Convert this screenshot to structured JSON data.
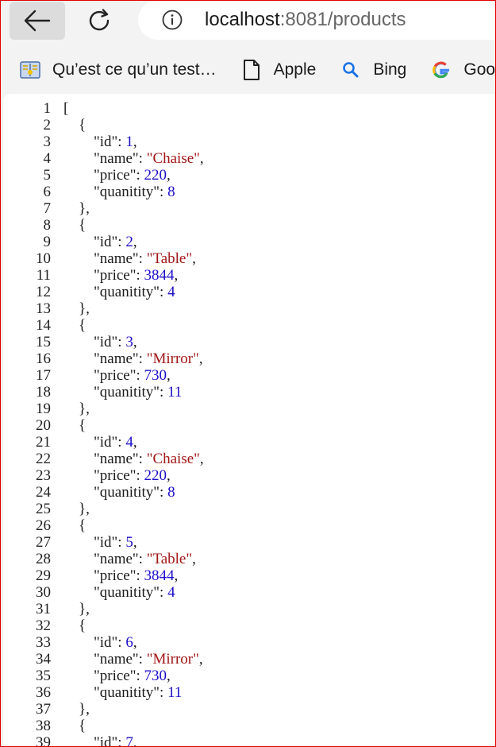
{
  "browser": {
    "url_host": "localhost",
    "url_rest": ":8081/products"
  },
  "bookmarks": [
    {
      "label": "Qu’est ce qu’un test…",
      "icon": "book-icon"
    },
    {
      "label": "Apple",
      "icon": "file-icon"
    },
    {
      "label": "Bing",
      "icon": "search-icon"
    },
    {
      "label": "Goog",
      "icon": "google-icon"
    }
  ],
  "json_lines": [
    {
      "n": "1",
      "parts": [
        [
          "p",
          "["
        ]
      ]
    },
    {
      "n": "2",
      "parts": [
        [
          "p",
          "    {"
        ]
      ]
    },
    {
      "n": "3",
      "parts": [
        [
          "p",
          "        \"id\": "
        ],
        [
          "num",
          "1"
        ],
        [
          "p",
          ","
        ]
      ]
    },
    {
      "n": "4",
      "parts": [
        [
          "p",
          "        \"name\": "
        ],
        [
          "str",
          "\"Chaise\""
        ],
        [
          "p",
          ","
        ]
      ]
    },
    {
      "n": "5",
      "parts": [
        [
          "p",
          "        \"price\": "
        ],
        [
          "num",
          "220"
        ],
        [
          "p",
          ","
        ]
      ]
    },
    {
      "n": "6",
      "parts": [
        [
          "p",
          "        \"quanitity\": "
        ],
        [
          "num",
          "8"
        ]
      ]
    },
    {
      "n": "7",
      "parts": [
        [
          "p",
          "    },"
        ]
      ]
    },
    {
      "n": "8",
      "parts": [
        [
          "p",
          "    {"
        ]
      ]
    },
    {
      "n": "9",
      "parts": [
        [
          "p",
          "        \"id\": "
        ],
        [
          "num",
          "2"
        ],
        [
          "p",
          ","
        ]
      ]
    },
    {
      "n": "10",
      "parts": [
        [
          "p",
          "        \"name\": "
        ],
        [
          "str",
          "\"Table\""
        ],
        [
          "p",
          ","
        ]
      ]
    },
    {
      "n": "11",
      "parts": [
        [
          "p",
          "        \"price\": "
        ],
        [
          "num",
          "3844"
        ],
        [
          "p",
          ","
        ]
      ]
    },
    {
      "n": "12",
      "parts": [
        [
          "p",
          "        \"quanitity\": "
        ],
        [
          "num",
          "4"
        ]
      ]
    },
    {
      "n": "13",
      "parts": [
        [
          "p",
          "    },"
        ]
      ]
    },
    {
      "n": "14",
      "parts": [
        [
          "p",
          "    {"
        ]
      ]
    },
    {
      "n": "15",
      "parts": [
        [
          "p",
          "        \"id\": "
        ],
        [
          "num",
          "3"
        ],
        [
          "p",
          ","
        ]
      ]
    },
    {
      "n": "16",
      "parts": [
        [
          "p",
          "        \"name\": "
        ],
        [
          "str",
          "\"Mirror\""
        ],
        [
          "p",
          ","
        ]
      ]
    },
    {
      "n": "17",
      "parts": [
        [
          "p",
          "        \"price\": "
        ],
        [
          "num",
          "730"
        ],
        [
          "p",
          ","
        ]
      ]
    },
    {
      "n": "18",
      "parts": [
        [
          "p",
          "        \"quanitity\": "
        ],
        [
          "num",
          "11"
        ]
      ]
    },
    {
      "n": "19",
      "parts": [
        [
          "p",
          "    },"
        ]
      ]
    },
    {
      "n": "20",
      "parts": [
        [
          "p",
          "    {"
        ]
      ]
    },
    {
      "n": "21",
      "parts": [
        [
          "p",
          "        \"id\": "
        ],
        [
          "num",
          "4"
        ],
        [
          "p",
          ","
        ]
      ]
    },
    {
      "n": "22",
      "parts": [
        [
          "p",
          "        \"name\": "
        ],
        [
          "str",
          "\"Chaise\""
        ],
        [
          "p",
          ","
        ]
      ]
    },
    {
      "n": "23",
      "parts": [
        [
          "p",
          "        \"price\": "
        ],
        [
          "num",
          "220"
        ],
        [
          "p",
          ","
        ]
      ]
    },
    {
      "n": "24",
      "parts": [
        [
          "p",
          "        \"quanitity\": "
        ],
        [
          "num",
          "8"
        ]
      ]
    },
    {
      "n": "25",
      "parts": [
        [
          "p",
          "    },"
        ]
      ]
    },
    {
      "n": "26",
      "parts": [
        [
          "p",
          "    {"
        ]
      ]
    },
    {
      "n": "27",
      "parts": [
        [
          "p",
          "        \"id\": "
        ],
        [
          "num",
          "5"
        ],
        [
          "p",
          ","
        ]
      ]
    },
    {
      "n": "28",
      "parts": [
        [
          "p",
          "        \"name\": "
        ],
        [
          "str",
          "\"Table\""
        ],
        [
          "p",
          ","
        ]
      ]
    },
    {
      "n": "29",
      "parts": [
        [
          "p",
          "        \"price\": "
        ],
        [
          "num",
          "3844"
        ],
        [
          "p",
          ","
        ]
      ]
    },
    {
      "n": "30",
      "parts": [
        [
          "p",
          "        \"quanitity\": "
        ],
        [
          "num",
          "4"
        ]
      ]
    },
    {
      "n": "31",
      "parts": [
        [
          "p",
          "    },"
        ]
      ]
    },
    {
      "n": "32",
      "parts": [
        [
          "p",
          "    {"
        ]
      ]
    },
    {
      "n": "33",
      "parts": [
        [
          "p",
          "        \"id\": "
        ],
        [
          "num",
          "6"
        ],
        [
          "p",
          ","
        ]
      ]
    },
    {
      "n": "34",
      "parts": [
        [
          "p",
          "        \"name\": "
        ],
        [
          "str",
          "\"Mirror\""
        ],
        [
          "p",
          ","
        ]
      ]
    },
    {
      "n": "35",
      "parts": [
        [
          "p",
          "        \"price\": "
        ],
        [
          "num",
          "730"
        ],
        [
          "p",
          ","
        ]
      ]
    },
    {
      "n": "36",
      "parts": [
        [
          "p",
          "        \"quanitity\": "
        ],
        [
          "num",
          "11"
        ]
      ]
    },
    {
      "n": "37",
      "parts": [
        [
          "p",
          "    },"
        ]
      ]
    },
    {
      "n": "38",
      "parts": [
        [
          "p",
          "    {"
        ]
      ]
    },
    {
      "n": "39",
      "parts": [
        [
          "p",
          "        \"id\": "
        ],
        [
          "num",
          "7"
        ],
        [
          "p",
          ","
        ]
      ]
    }
  ],
  "colors": {
    "string": "#a31515",
    "number": "#1c10c8",
    "frame": "#e00000"
  }
}
